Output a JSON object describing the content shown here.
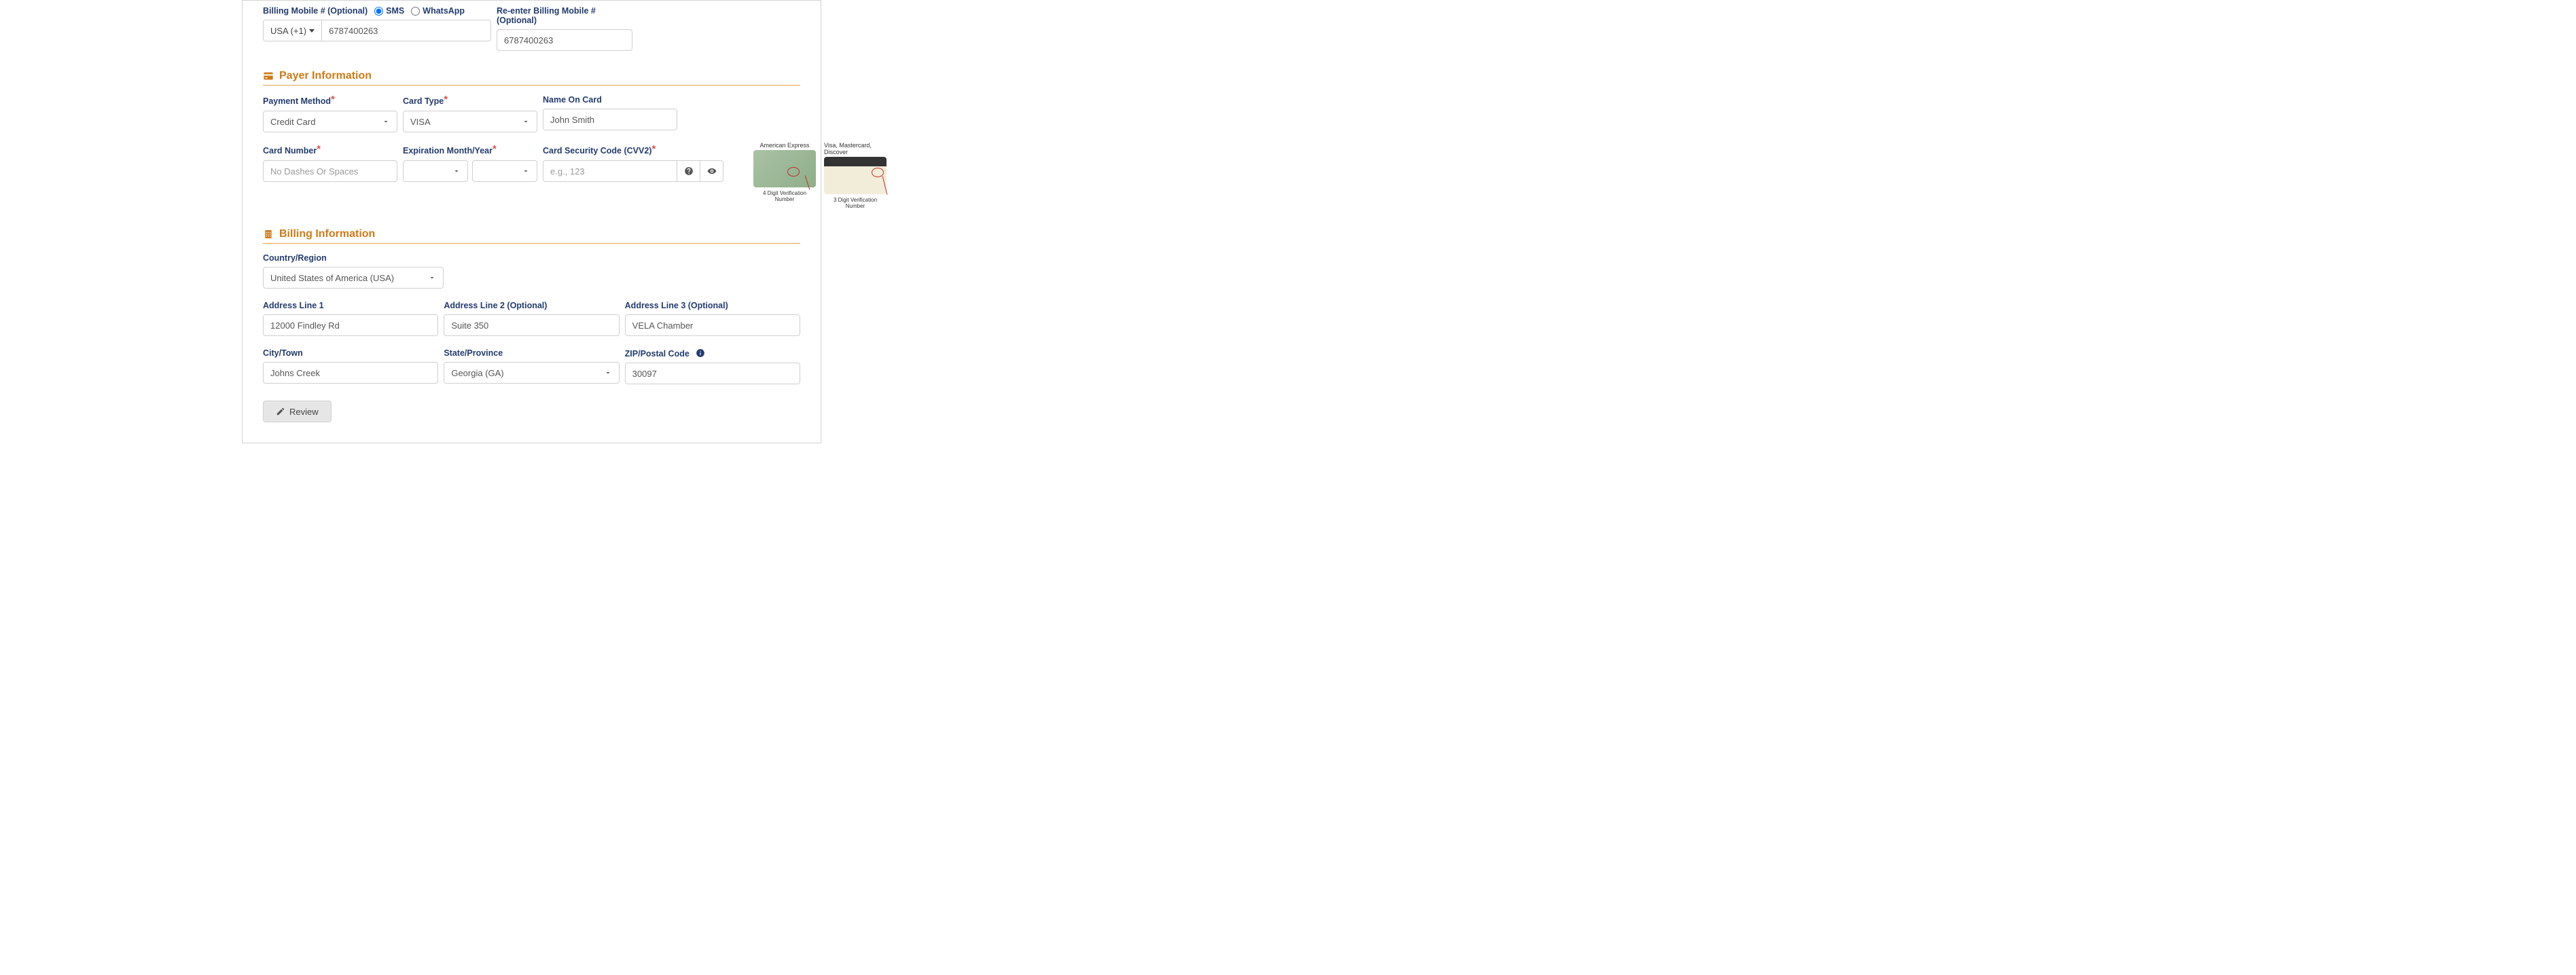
{
  "mobile": {
    "label": "Billing Mobile # (Optional)",
    "sms": "SMS",
    "whatsapp": "WhatsApp",
    "country_code": "USA (+1)",
    "value": "6787400263",
    "reenter_label": "Re-enter Billing Mobile # (Optional)",
    "reenter_value": "6787400263"
  },
  "payer": {
    "section": "Payer Information",
    "payment_method_label": "Payment Method",
    "payment_method_value": "Credit Card",
    "card_type_label": "Card Type",
    "card_type_value": "VISA",
    "name_label": "Name On Card",
    "name_value": "John Smith",
    "card_number_label": "Card Number",
    "card_number_placeholder": "No Dashes Or Spaces",
    "exp_label": "Expiration Month/Year",
    "cvv_label": "Card Security Code (CVV2)",
    "cvv_placeholder": "e.g., 123",
    "amex_title": "American Express",
    "amex_caption": "4 Digit Verification Number",
    "other_title": "Visa, Mastercard, Discover",
    "other_caption": "3 Digit Verification Number"
  },
  "billing": {
    "section": "Billing Information",
    "country_label": "Country/Region",
    "country_value": "United States of America (USA)",
    "addr1_label": "Address Line 1",
    "addr1_value": "12000 Findley Rd",
    "addr2_label": "Address Line 2 (Optional)",
    "addr2_value": "Suite 350",
    "addr3_label": "Address Line 3 (Optional)",
    "addr3_value": "VELA Chamber",
    "city_label": "City/Town",
    "city_value": "Johns Creek",
    "state_label": "State/Province",
    "state_value": "Georgia (GA)",
    "zip_label": "ZIP/Postal Code",
    "zip_value": "30097"
  },
  "actions": {
    "review": "Review"
  }
}
